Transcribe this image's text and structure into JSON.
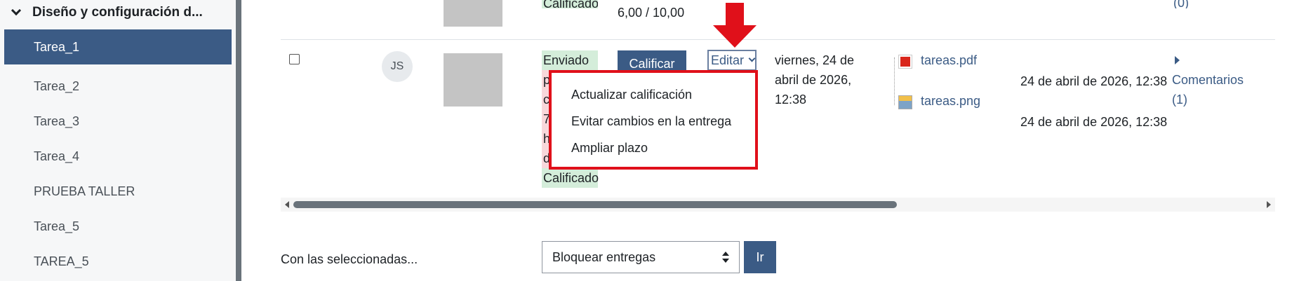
{
  "sidebar": {
    "section_title": "Diseño y configuración d...",
    "items": [
      {
        "label": "Tarea_1",
        "active": true
      },
      {
        "label": "Tarea_2",
        "active": false
      },
      {
        "label": "Tarea_3",
        "active": false
      },
      {
        "label": "Tarea_4",
        "active": false
      },
      {
        "label": "PRUEBA TALLER",
        "active": false
      },
      {
        "label": "Tarea_5",
        "active": false
      },
      {
        "label": "TAREA_5",
        "active": false
      }
    ]
  },
  "prev_row": {
    "status": "Calificado",
    "grade": "6,00 / 10,00",
    "comments_count": "(0)"
  },
  "row": {
    "initials": "JS",
    "status_lines": [
      "Enviado",
      "pa",
      "ca",
      "7",
      "ho",
      "de",
      "Calificado"
    ],
    "grade_button": "Calificar",
    "edit_label": "Editar",
    "edit_menu": [
      "Actualizar calificación",
      "Evitar cambios en la entrega",
      "Ampliar plazo"
    ],
    "last_modified": [
      "viernes, 24 de",
      "abril de 2026,",
      "12:38"
    ],
    "files": [
      {
        "name": "tareas.pdf",
        "icon": "pdf-file-icon",
        "date": "24 de abril de 2026, 12:38"
      },
      {
        "name": "tareas.png",
        "icon": "image-file-icon",
        "date": "24 de abril de 2026, 12:38"
      }
    ],
    "comments_label": "Comentarios",
    "comments_count": "(1)"
  },
  "bulk": {
    "label": "Con las seleccionadas...",
    "selected_option": "Bloquear entregas",
    "go_button": "Ir"
  },
  "colors": {
    "primary": "#3b5b85",
    "highlight_red": "#e0101a",
    "status_green": "#d4edda",
    "status_red": "#f8d7da"
  }
}
